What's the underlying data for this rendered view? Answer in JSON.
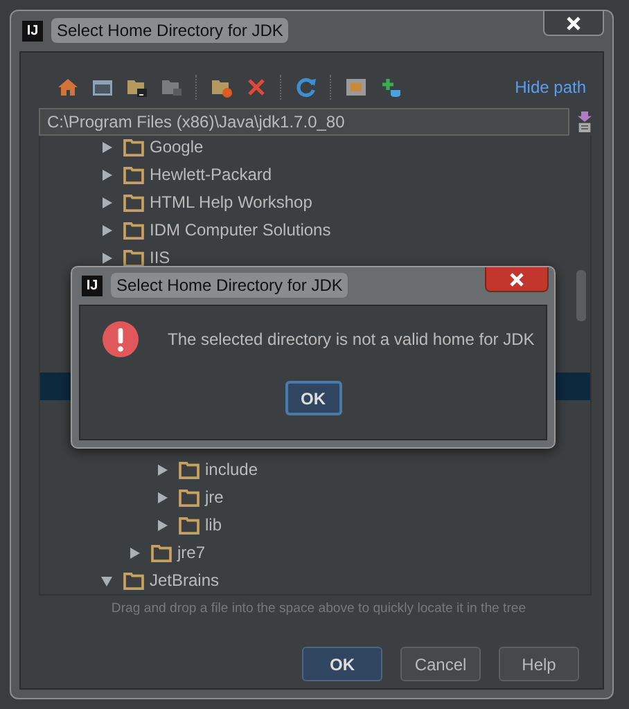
{
  "window": {
    "app_icon": "IJ",
    "title": "Select Home Directory for JDK",
    "hide_path_link": "Hide path",
    "path": "C:\\Program Files (x86)\\Java\\jdk1.7.0_80",
    "tree": [
      {
        "label": "Google",
        "expanded": false,
        "selected": false
      },
      {
        "label": "Hewlett-Packard",
        "expanded": false,
        "selected": false
      },
      {
        "label": "HTML Help Workshop",
        "expanded": false,
        "selected": false
      },
      {
        "label": "IDM Computer Solutions",
        "expanded": false,
        "selected": false
      },
      {
        "label": "IIS",
        "expanded": false,
        "selected": false
      },
      {
        "expanded": true,
        "children": [
          {
            "expanded": true,
            "selected": true,
            "children": [
              {
                "label": "include",
                "expanded": false,
                "selected": false
              },
              {
                "label": "jre",
                "expanded": false,
                "selected": false
              },
              {
                "label": "lib",
                "expanded": false,
                "selected": false
              }
            ]
          },
          {
            "label": "jre7",
            "expanded": false,
            "selected": false
          }
        ]
      },
      {
        "label": "JetBrains",
        "expanded": true,
        "selected": false
      }
    ],
    "hint": "Drag and drop a file into the space above to quickly locate it in the tree",
    "buttons": [
      {
        "label": "OK",
        "default": true
      },
      {
        "label": "Cancel",
        "default": false
      },
      {
        "label": "Help",
        "default": false
      }
    ]
  },
  "alert": {
    "app_icon": "IJ",
    "title": "Select Home Directory for JDK",
    "message": "The selected directory is not a valid home for JDK",
    "button": "OK"
  }
}
